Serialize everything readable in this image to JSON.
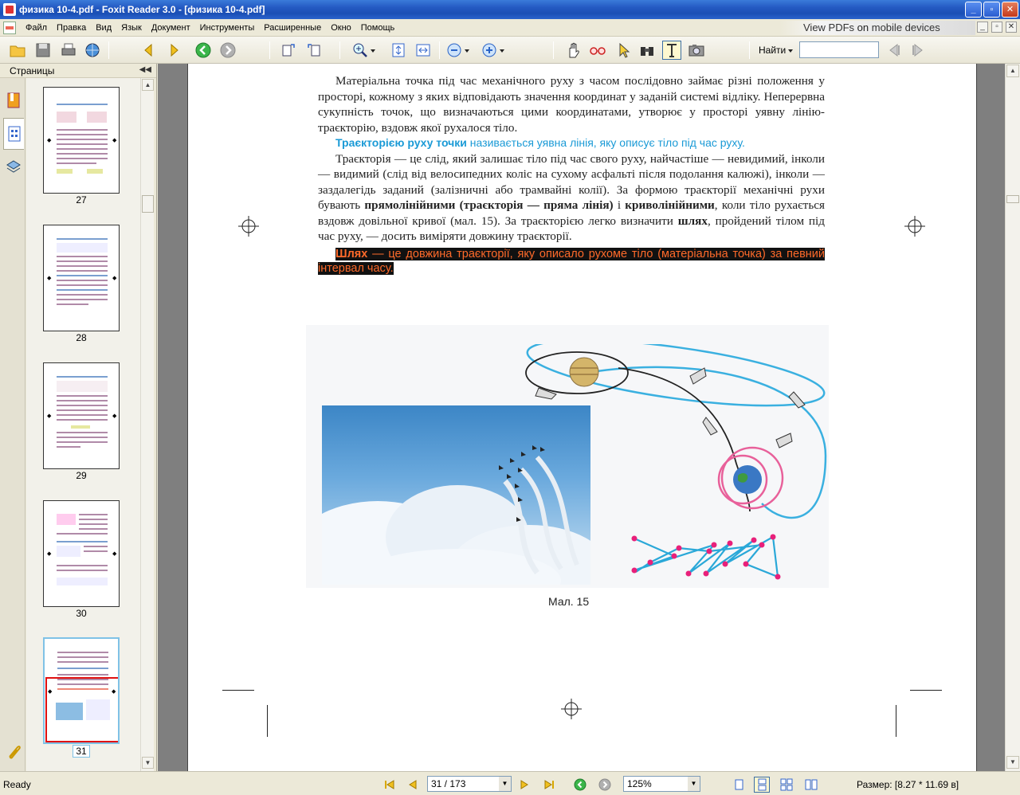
{
  "window": {
    "title": "физика 10-4.pdf - Foxit Reader 3.0 - [физика 10-4.pdf]",
    "min_label": "_",
    "max_label": "▫",
    "close_label": "✕"
  },
  "menu": {
    "items": [
      "Файл",
      "Правка",
      "Вид",
      "Язык",
      "Документ",
      "Инструменты",
      "Расширенные",
      "Окно",
      "Помощь"
    ],
    "promo_prefix": "View PDFs ",
    "promo_on": "on",
    "promo_suffix": " mobile devices"
  },
  "toolbar": {
    "find_label": "Найти",
    "find_value": ""
  },
  "sidebar": {
    "title": "Страницы",
    "thumbnails": [
      {
        "page": "27"
      },
      {
        "page": "28"
      },
      {
        "page": "29"
      },
      {
        "page": "30"
      },
      {
        "page": "31"
      }
    ],
    "current_page": "31"
  },
  "document": {
    "para1": "Матеріальна точка під час механічного руху з часом послідовно займає різні положення у просторі, кожному з яких відповідають значення координат у заданій системі відліку. Неперервна сукупність точок, що визначаються цими координатами, утворює у просторі уявну лінію-траєкторію, вздовж якої рухалося тіло.",
    "def1_term": "Траєкторією руху точки",
    "def1_rest": " називається уявна лінія, яку описує тіло під час руху.",
    "para2_a": "Траєкторія — це слід, який залишає тіло під час свого руху, найчастіше — невидимий, інколи — видимий (слід від велосипедних коліс на сухому асфальті після подолання калюжі), інколи — заздалегідь заданий (залізничні або трамвайні колії). За формою траєкторії механічні рухи бувають ",
    "para2_b": "прямолінійними (траєкторія — пряма лінія)",
    "para2_c": " і ",
    "para2_d": "криволінійними",
    "para2_e": ", коли тіло рухається вздовж довільної кривої (мал. 15). За траєкторією легко визначити ",
    "para2_f": "шлях",
    "para2_g": ", пройдений тілом під час руху, — досить виміряти довжину траєкторії.",
    "def2_term": "Шлях",
    "def2_rest": " — це довжина траєкторії, яку описало рухоме тіло (матеріальна точка) за певний інтервал часу.",
    "caption": "Мал. 15"
  },
  "status": {
    "ready": "Ready",
    "page_field": "31 / 173",
    "zoom": "125%",
    "size": "Размер: [8.27 * 11.69 в]"
  },
  "colors": {
    "definition_blue": "#1a9ad6",
    "highlight_orange": "#ff6a2a",
    "orbit_blue": "#3ab0e0",
    "orbit_pink": "#e8609a"
  }
}
